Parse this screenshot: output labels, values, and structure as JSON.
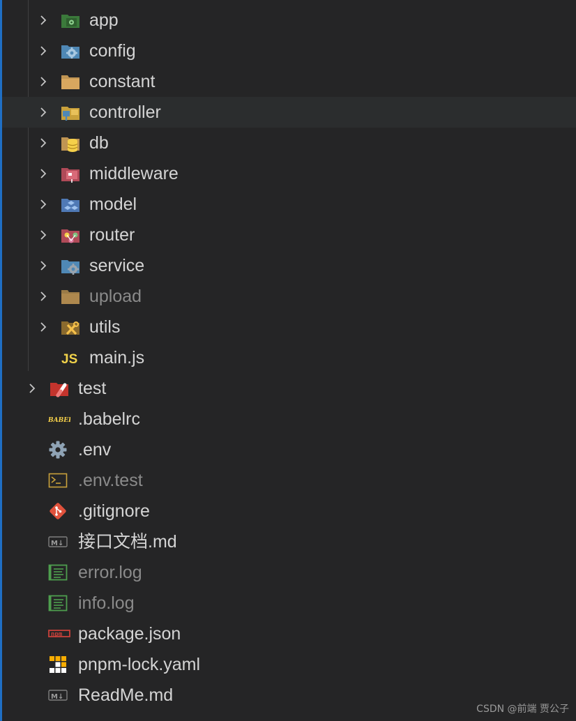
{
  "explorer": {
    "items": [
      {
        "name": "app",
        "kind": "folder",
        "icon": "folder-app-icon",
        "ignored": false
      },
      {
        "name": "config",
        "kind": "folder",
        "icon": "folder-config-icon",
        "ignored": false
      },
      {
        "name": "constant",
        "kind": "folder",
        "icon": "folder-icon",
        "ignored": false
      },
      {
        "name": "controller",
        "kind": "folder",
        "icon": "folder-controller-icon",
        "ignored": false
      },
      {
        "name": "db",
        "kind": "folder",
        "icon": "folder-db-icon",
        "ignored": false
      },
      {
        "name": "middleware",
        "kind": "folder",
        "icon": "folder-middleware-icon",
        "ignored": false
      },
      {
        "name": "model",
        "kind": "folder",
        "icon": "folder-model-icon",
        "ignored": false
      },
      {
        "name": "router",
        "kind": "folder",
        "icon": "folder-router-icon",
        "ignored": false
      },
      {
        "name": "service",
        "kind": "folder",
        "icon": "folder-service-icon",
        "ignored": false
      },
      {
        "name": "upload",
        "kind": "folder",
        "icon": "folder-icon",
        "ignored": true
      },
      {
        "name": "utils",
        "kind": "folder",
        "icon": "folder-utils-icon",
        "ignored": false
      },
      {
        "name": "main.js",
        "kind": "file",
        "icon": "javascript-file-icon",
        "icon_text": "JS",
        "ignored": false
      },
      {
        "name": "test",
        "kind": "folder",
        "icon": "folder-test-icon",
        "ignored": false
      },
      {
        "name": ".babelrc",
        "kind": "file",
        "icon": "babel-file-icon",
        "icon_text": "BABEL",
        "ignored": false
      },
      {
        "name": ".env",
        "kind": "file",
        "icon": "gear-icon",
        "ignored": false
      },
      {
        "name": ".env.test",
        "kind": "file",
        "icon": "terminal-file-icon",
        "ignored": true
      },
      {
        "name": ".gitignore",
        "kind": "file",
        "icon": "git-file-icon",
        "ignored": false
      },
      {
        "name": "接口文档.md",
        "kind": "file",
        "icon": "markdown-file-icon",
        "icon_text": "M↓",
        "ignored": false
      },
      {
        "name": "error.log",
        "kind": "file",
        "icon": "log-file-icon",
        "ignored": true
      },
      {
        "name": "info.log",
        "kind": "file",
        "icon": "log-file-icon",
        "ignored": true
      },
      {
        "name": "package.json",
        "kind": "file",
        "icon": "npm-file-icon",
        "icon_text": "npm",
        "ignored": false
      },
      {
        "name": "pnpm-lock.yaml",
        "kind": "file",
        "icon": "pnpm-file-icon",
        "ignored": false
      },
      {
        "name": "ReadMe.md",
        "kind": "file",
        "icon": "markdown-file-icon",
        "icon_text": "M↓",
        "ignored": false
      }
    ]
  },
  "watermark": "CSDN @前端 贾公子",
  "colors": {
    "background": "#252526",
    "hover_row": "#2b2d2e",
    "text": "#d4d4d4",
    "ignored_text": "#8a8a8a",
    "accent_edge": "#1f6fc4"
  }
}
